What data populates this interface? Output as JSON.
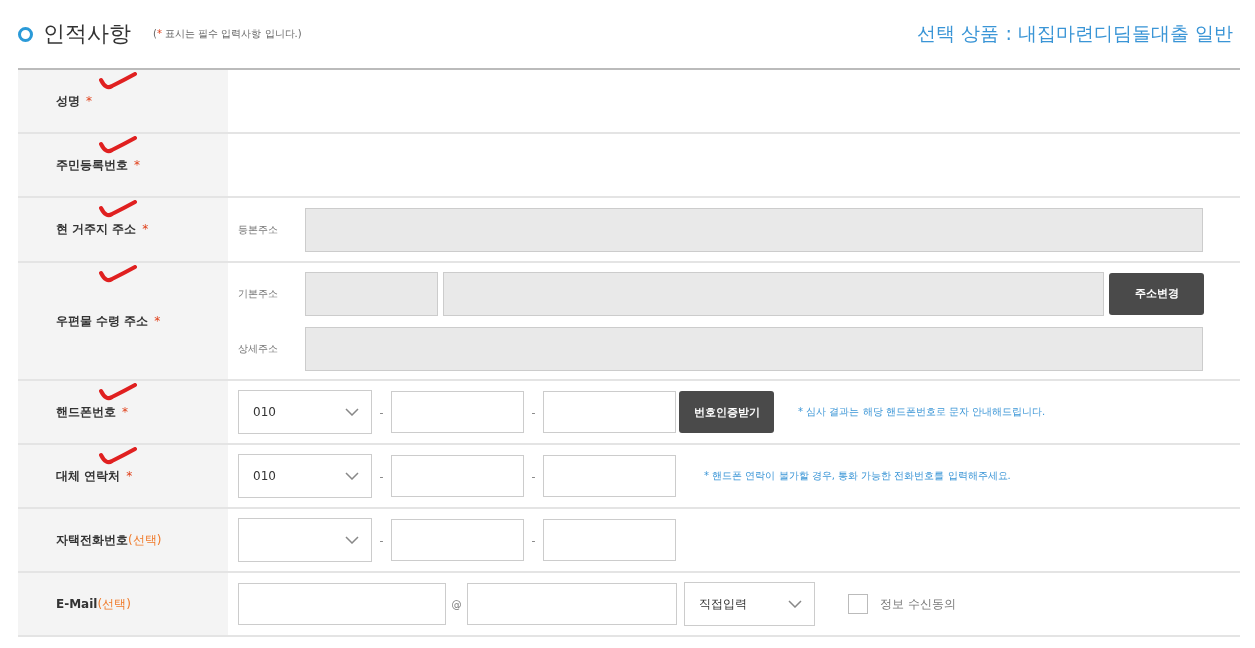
{
  "title": "인적사항",
  "required_note": {
    "open": "(",
    "mark": "*",
    "text": " 표시는 필수 입력사항 입니다.)"
  },
  "product": "선택 상품 : 내집마련디딤돌대출 일반",
  "rows": [
    {
      "label": "성명",
      "marker": {
        "kind": "required",
        "text": "*"
      },
      "annotated": true,
      "kind": "empty"
    },
    {
      "label": "주민등록번호",
      "marker": {
        "kind": "required",
        "text": "*"
      },
      "annotated": true,
      "kind": "empty"
    },
    {
      "label": "현 거주지 주소",
      "marker": {
        "kind": "required",
        "text": "*"
      },
      "annotated": true,
      "kind": "address",
      "lines": [
        {
          "label": "등본주소",
          "kind": "full",
          "disabled": true
        }
      ]
    },
    {
      "label": "우편물 수령 주소",
      "marker": {
        "kind": "required",
        "text": "*"
      },
      "annotated": true,
      "kind": "address",
      "lines": [
        {
          "label": "기본주소",
          "kind": "zip",
          "disabled": true,
          "button": "주소변경"
        },
        {
          "label": "상세주소",
          "kind": "full",
          "disabled": true
        }
      ]
    },
    {
      "label": "핸드폰번호",
      "marker": {
        "kind": "required",
        "text": "*"
      },
      "annotated": true,
      "kind": "phone",
      "select": "010",
      "separators": [
        "-",
        "-"
      ],
      "button": "번호인증받기",
      "note": "* 심사 결과는 해당 핸드폰번호로 문자 안내해드립니다."
    },
    {
      "label": "대체 연락처",
      "marker": {
        "kind": "required",
        "text": "*"
      },
      "annotated": true,
      "kind": "phone",
      "select": "010",
      "separators": [
        "-",
        "-"
      ],
      "note": "* 핸드폰 연락이 불가할 경우, 통화 가능한 전화번호를 입력해주세요."
    },
    {
      "label": "자택전화번호",
      "marker": {
        "kind": "optional",
        "text": "(선택)"
      },
      "annotated": false,
      "kind": "phone",
      "separators": [
        "-",
        "-"
      ]
    },
    {
      "label": "E-Mail",
      "marker": {
        "kind": "optional",
        "text": "(선택)"
      },
      "annotated": false,
      "kind": "email",
      "at": "@",
      "select": "직접입력",
      "consent": {
        "label": "정보 수신동의",
        "checked": false
      }
    }
  ]
}
